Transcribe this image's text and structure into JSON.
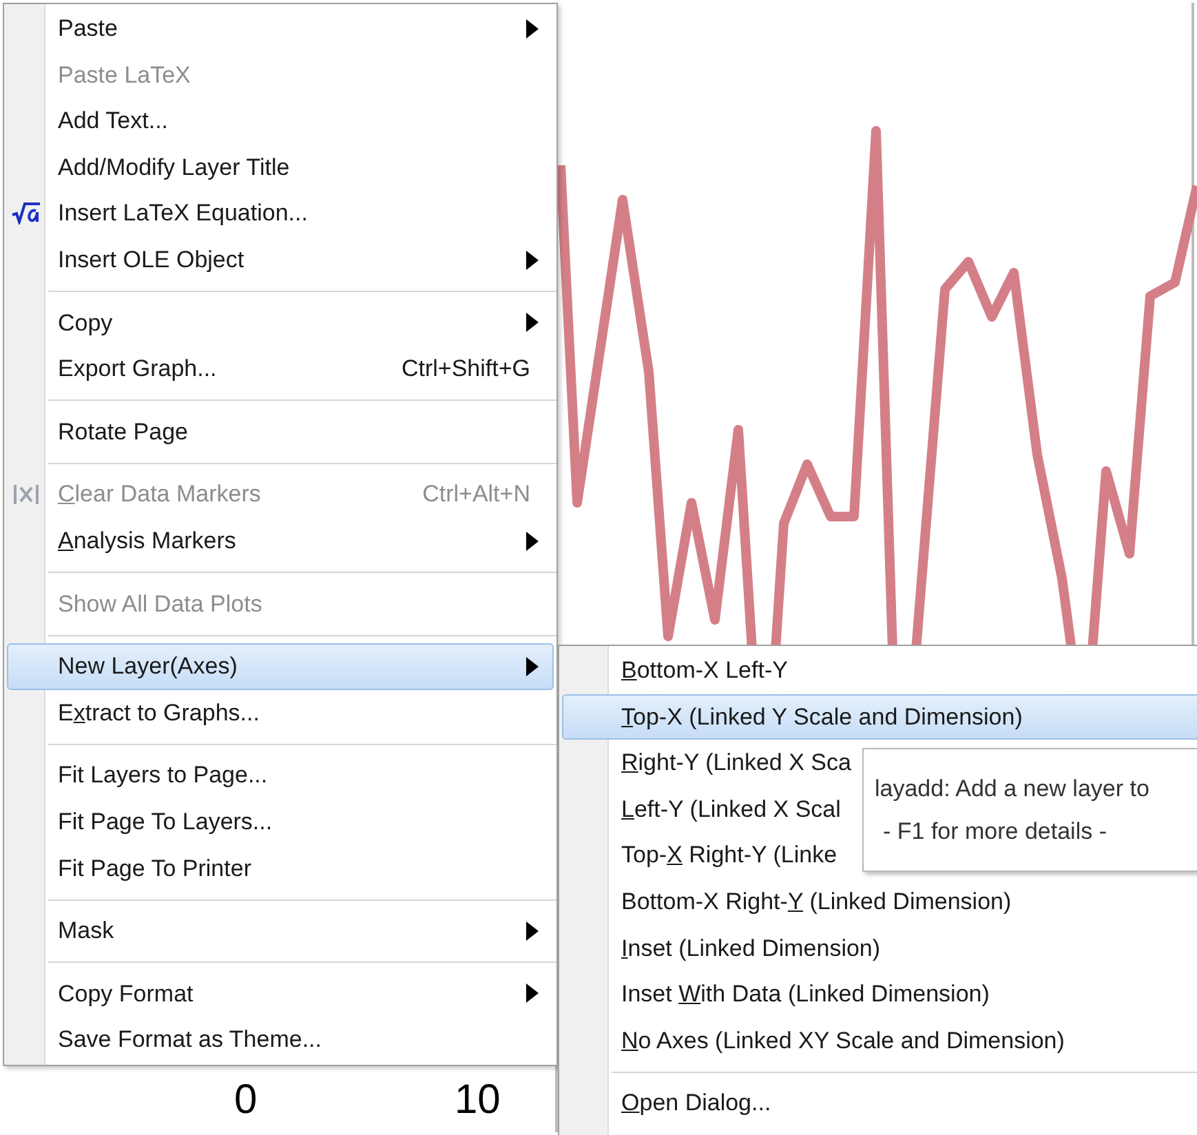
{
  "graph": {
    "tick_labels": [
      "0",
      "10"
    ]
  },
  "context_menu": {
    "items": [
      {
        "kind": "item",
        "label": "Paste",
        "disabled": false,
        "submenu": true,
        "highlighted": false
      },
      {
        "kind": "item",
        "label": "Paste LaTeX",
        "disabled": true,
        "submenu": false,
        "highlighted": false
      },
      {
        "kind": "item",
        "label": "Add Text...",
        "disabled": false,
        "submenu": false,
        "highlighted": false
      },
      {
        "kind": "item",
        "label": "Add/Modify Layer Title",
        "disabled": false,
        "submenu": false,
        "highlighted": false
      },
      {
        "kind": "equation",
        "label": "Insert LaTeX Equation...",
        "disabled": false,
        "submenu": false,
        "highlighted": false
      },
      {
        "kind": "item",
        "label": "Insert OLE Object",
        "disabled": false,
        "submenu": true,
        "highlighted": false
      },
      {
        "kind": "separator"
      },
      {
        "kind": "item",
        "label": "Copy",
        "disabled": false,
        "submenu": true,
        "highlighted": false
      },
      {
        "kind": "item",
        "label": "Export Graph...",
        "disabled": false,
        "submenu": false,
        "highlighted": false,
        "shortcut": "Ctrl+Shift+G"
      },
      {
        "kind": "separator"
      },
      {
        "kind": "item",
        "label": "Rotate Page",
        "disabled": false,
        "submenu": false,
        "highlighted": false
      },
      {
        "kind": "separator"
      },
      {
        "kind": "markers",
        "key": "C",
        "post": "lear Data Markers",
        "disabled": true,
        "submenu": false,
        "highlighted": false,
        "shortcut": "Ctrl+Alt+N"
      },
      {
        "kind": "item",
        "key": "A",
        "post": "nalysis Markers",
        "disabled": false,
        "submenu": true,
        "highlighted": false
      },
      {
        "kind": "separator"
      },
      {
        "kind": "item",
        "label": "Show All Data Plots",
        "disabled": true,
        "submenu": false,
        "highlighted": false
      },
      {
        "kind": "separator"
      },
      {
        "kind": "item",
        "label": "New Layer(Axes)",
        "disabled": false,
        "submenu": true,
        "highlighted": true
      },
      {
        "kind": "item",
        "pre": "E",
        "key": "x",
        "post": "tract to Graphs...",
        "disabled": false,
        "submenu": false,
        "highlighted": false
      },
      {
        "kind": "separator"
      },
      {
        "kind": "item",
        "label": "Fit Layers to Page...",
        "disabled": false,
        "submenu": false,
        "highlighted": false
      },
      {
        "kind": "item",
        "label": "Fit Page To Layers...",
        "disabled": false,
        "submenu": false,
        "highlighted": false
      },
      {
        "kind": "item",
        "label": "Fit Page To Printer",
        "disabled": false,
        "submenu": false,
        "highlighted": false
      },
      {
        "kind": "separator"
      },
      {
        "kind": "item",
        "label": "Mask",
        "disabled": false,
        "submenu": true,
        "highlighted": false
      },
      {
        "kind": "separator"
      },
      {
        "kind": "item",
        "label": "Copy Format",
        "disabled": false,
        "submenu": true,
        "highlighted": false
      },
      {
        "kind": "item",
        "label": "Save Format as Theme...",
        "disabled": false,
        "submenu": false,
        "highlighted": false
      }
    ]
  },
  "submenu": {
    "items": [
      {
        "kind": "item",
        "key": "B",
        "post": "ottom-X Left-Y",
        "highlighted": false
      },
      {
        "kind": "item",
        "key": "T",
        "post": "op-X (Linked Y Scale and Dimension)",
        "highlighted": true
      },
      {
        "kind": "item",
        "key": "R",
        "post": "ight-Y (Linked X Sca",
        "highlighted": false
      },
      {
        "kind": "item",
        "key": "L",
        "post": "eft-Y (Linked X Scal",
        "highlighted": false
      },
      {
        "kind": "item",
        "pre": "Top-",
        "key": "X",
        "post": " Right-Y (Linke",
        "highlighted": false
      },
      {
        "kind": "item",
        "pre": "Bottom-X Right-",
        "key": "Y",
        "post": " (Linked Dimension)",
        "highlighted": false
      },
      {
        "kind": "item",
        "key": "I",
        "post": "nset (Linked Dimension)",
        "highlighted": false
      },
      {
        "kind": "item",
        "pre": "Inset ",
        "key": "W",
        "post": "ith Data (Linked Dimension)",
        "highlighted": false
      },
      {
        "kind": "item",
        "key": "N",
        "post": "o Axes (Linked XY Scale and Dimension)",
        "highlighted": false
      },
      {
        "kind": "separator"
      },
      {
        "kind": "item",
        "key": "O",
        "post": "pen Dialog...",
        "highlighted": false
      }
    ]
  },
  "tooltip": {
    "lines": [
      "layadd: Add a new layer to",
      "- F1 for more details -"
    ]
  }
}
